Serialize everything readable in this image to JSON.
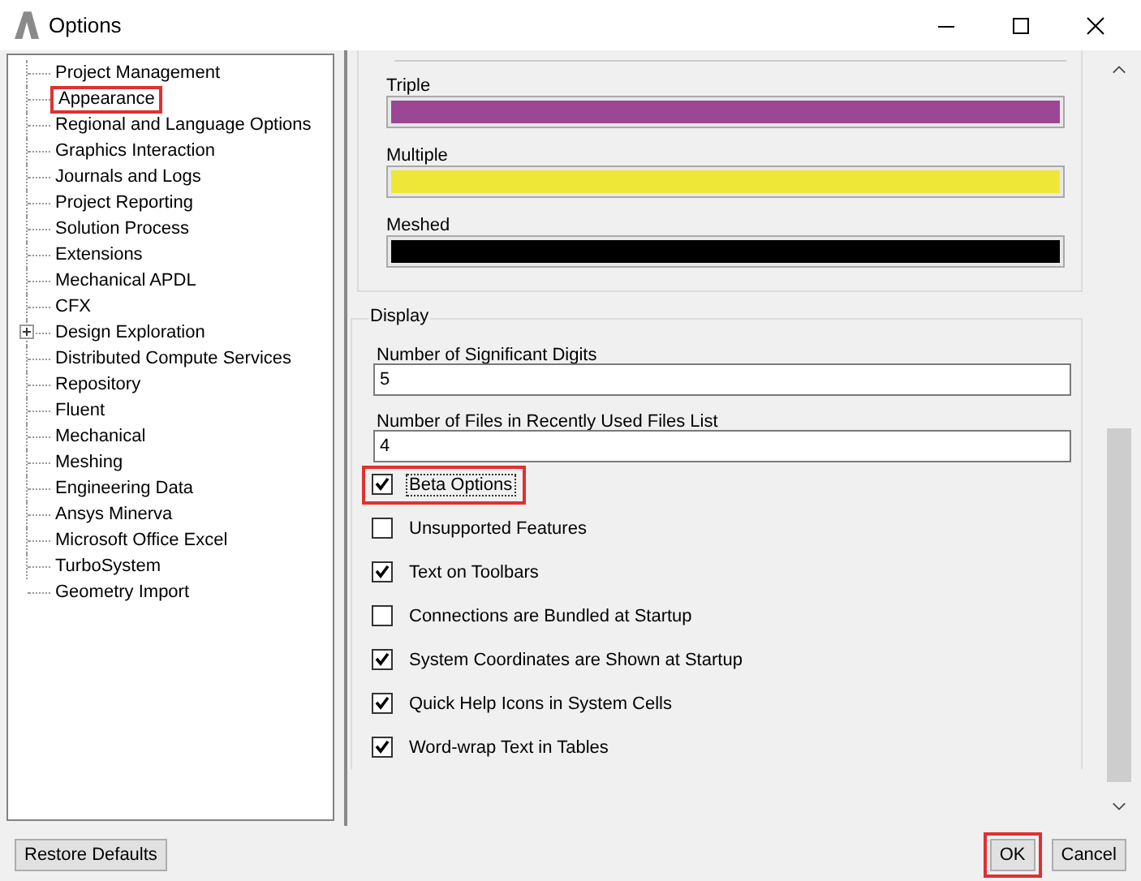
{
  "window": {
    "title": "Options"
  },
  "tree": [
    {
      "label": "Project Management",
      "highlighted": false
    },
    {
      "label": "Appearance",
      "highlighted": true
    },
    {
      "label": "Regional and Language Options",
      "highlighted": false
    },
    {
      "label": "Graphics Interaction",
      "highlighted": false
    },
    {
      "label": "Journals and Logs",
      "highlighted": false
    },
    {
      "label": "Project Reporting",
      "highlighted": false
    },
    {
      "label": "Solution Process",
      "highlighted": false
    },
    {
      "label": "Extensions",
      "highlighted": false
    },
    {
      "label": "Mechanical APDL",
      "highlighted": false
    },
    {
      "label": "CFX",
      "highlighted": false
    },
    {
      "label": "Design Exploration",
      "highlighted": false,
      "expanded": false
    },
    {
      "label": "Distributed Compute Services",
      "highlighted": false
    },
    {
      "label": "Repository",
      "highlighted": false
    },
    {
      "label": "Fluent",
      "highlighted": false
    },
    {
      "label": "Mechanical",
      "highlighted": false
    },
    {
      "label": "Meshing",
      "highlighted": false
    },
    {
      "label": "Engineering Data",
      "highlighted": false
    },
    {
      "label": "Ansys Minerva",
      "highlighted": false
    },
    {
      "label": "Microsoft Office Excel",
      "highlighted": false
    },
    {
      "label": "TurboSystem",
      "highlighted": false
    },
    {
      "label": "Geometry Import",
      "highlighted": false
    }
  ],
  "colors": [
    {
      "label": "Triple",
      "color": "#9b4795"
    },
    {
      "label": "Multiple",
      "color": "#eee737"
    },
    {
      "label": "Meshed",
      "color": "#000000"
    }
  ],
  "display": {
    "title": "Display",
    "fields": [
      {
        "label": "Number of Significant Digits",
        "value": "5"
      },
      {
        "label": "Number of Files in Recently Used Files List",
        "value": "4"
      }
    ],
    "checkboxes": [
      {
        "label": "Beta Options",
        "checked": true,
        "highlighted": true
      },
      {
        "label": "Unsupported Features",
        "checked": false,
        "highlighted": false
      },
      {
        "label": "Text on Toolbars",
        "checked": true,
        "highlighted": false
      },
      {
        "label": "Connections are Bundled at Startup",
        "checked": false,
        "highlighted": false
      },
      {
        "label": "System Coordinates are Shown at Startup",
        "checked": true,
        "highlighted": false
      },
      {
        "label": "Quick Help Icons in System Cells",
        "checked": true,
        "highlighted": false
      },
      {
        "label": "Word-wrap Text in Tables",
        "checked": true,
        "highlighted": false
      }
    ]
  },
  "buttons": [
    {
      "label": "Restore Defaults",
      "highlighted": false
    },
    {
      "label": "OK",
      "highlighted": true
    },
    {
      "label": "Cancel",
      "highlighted": false
    }
  ]
}
